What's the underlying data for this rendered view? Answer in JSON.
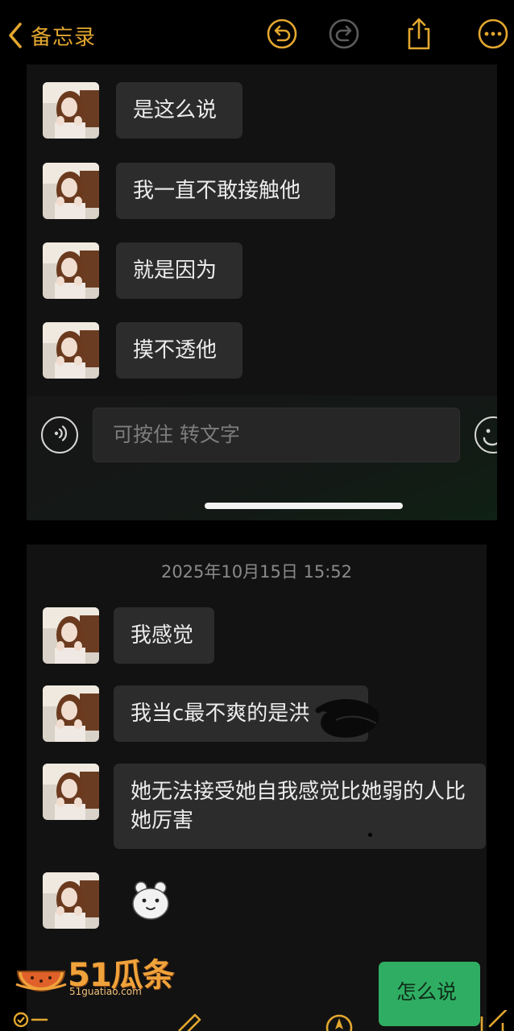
{
  "header": {
    "back_label": "备忘录",
    "accent_color": "#e3a72f",
    "icons": [
      "chevron-left-icon",
      "undo-icon",
      "redo-icon",
      "share-icon",
      "more-icon"
    ]
  },
  "chat1": {
    "messages": [
      {
        "text": "是这么说"
      },
      {
        "text": "我一直不敢接触他"
      },
      {
        "text": "就是因为"
      },
      {
        "text": "摸不透他"
      }
    ],
    "input_placeholder": "可按住 转文字"
  },
  "chat2": {
    "timestamp": "2025年10月15日 15:52",
    "messages": [
      {
        "text": "我感觉"
      },
      {
        "text": "我当c最不爽的是洪"
      },
      {
        "text": "她无法接受她自我感觉比她弱的人比她厉害"
      }
    ],
    "sent_message": "怎么说",
    "sent_color": "#2fae63"
  },
  "watermark": {
    "name": "51瓜条",
    "url": "51guatiao.com"
  },
  "toolbar": {
    "icons": [
      "checklist-icon",
      "pen-icon",
      "compass-icon",
      "compose-icon"
    ]
  }
}
